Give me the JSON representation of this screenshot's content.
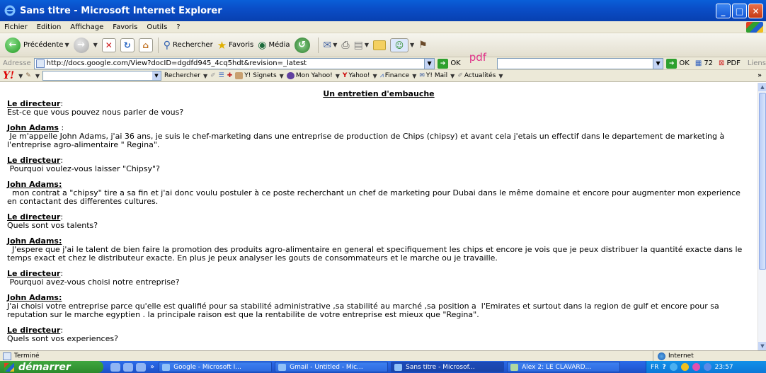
{
  "window": {
    "title": "Sans titre - Microsoft Internet Explorer"
  },
  "menu": [
    "Fichier",
    "Edition",
    "Affichage",
    "Favoris",
    "Outils",
    "?"
  ],
  "toolbar": {
    "back_label": "Précédente",
    "search_label": "Rechercher",
    "favorites_label": "Favoris",
    "media_label": "Média"
  },
  "address": {
    "label": "Adresse",
    "url": "http://docs.google.com/View?docID=dgdfd945_4cq5hdt&revision=_latest",
    "go_label": "OK",
    "pdf_label": "pdf -",
    "go2_label": "OK",
    "count": "72",
    "pdf_button": "PDF",
    "links_label": "Liens"
  },
  "yahoo": {
    "search_button": "Rechercher",
    "items": [
      "Y! Signets",
      "Mon Yahoo!",
      "Yahoo!",
      "Finance",
      "Y! Mail",
      "Actualités"
    ]
  },
  "document": {
    "title": "Un entretien d'embauche",
    "blocks": [
      {
        "speaker": "Le directeur",
        "suffix": ":",
        "text": "Est-ce que vous pouvez nous parler de vous?"
      },
      {
        "speaker": "John Adams",
        "suffix": " :",
        "text": " Je m'appelle John Adams, j'ai 36 ans, je suis le chef-marketing dans une entreprise de production de Chips (chipsy) et avant cela j'etais un effectif dans le departement de marketing à l'entreprise agro-alimentaire \" Regina\"."
      },
      {
        "speaker": "Le directeur",
        "suffix": ":",
        "text": " Pourquoi voulez-vous laisser \"Chipsy\"?"
      },
      {
        "speaker": "John Adams:",
        "suffix": "",
        "text": "  mon contrat a \"chipsy\" tire a sa fin et j'ai donc voulu postuler à ce poste recherchant un chef de marketing pour Dubai dans le même domaine et encore pour augmenter mon experience en contactant des differentes cultures."
      },
      {
        "speaker": "Le directeur",
        "suffix": ":",
        "text": "Quels sont vos talents?"
      },
      {
        "speaker": "John Adams:",
        "suffix": "",
        "text": "  J'espere que j'ai le talent de bien faire la promotion des produits agro-alimentaire en general et specifiquement les chips et encore je vois que je peux distribuer la quantité exacte dans le temps exact et chez le distributeur exacte. En plus je peux analyser les gouts de consommateurs et le marche ou je travaille."
      },
      {
        "speaker": "Le directeur",
        "suffix": ":",
        "text": " Pourquoi avez-vous choisi notre entreprise?"
      },
      {
        "speaker": "John Adams:",
        "suffix": "",
        "text": "J'ai choisi votre entreprise parce qu'elle est qualifié pour sa stabilité administrative ,sa stabilité au marché ,sa position a  l'Emirates et surtout dans la region de gulf et encore pour sa reputation sur le marche egyptien . la principale raison est que la rentabilite de votre entreprise est mieux que \"Regina\"."
      },
      {
        "speaker": "Le directeur",
        "suffix": ":",
        "text": "Quels sont vos experiences?"
      }
    ]
  },
  "status": {
    "text": "Terminé",
    "zone": "Internet"
  },
  "taskbar": {
    "start": "démarrer",
    "more": "»",
    "tasks": [
      "Google - Microsoft I...",
      "Gmail - Untitled - Mic...",
      "Sans titre - Microsof...",
      "Alex 2: LE CLAVARD..."
    ],
    "lang": "FR",
    "clock": "23:57"
  }
}
